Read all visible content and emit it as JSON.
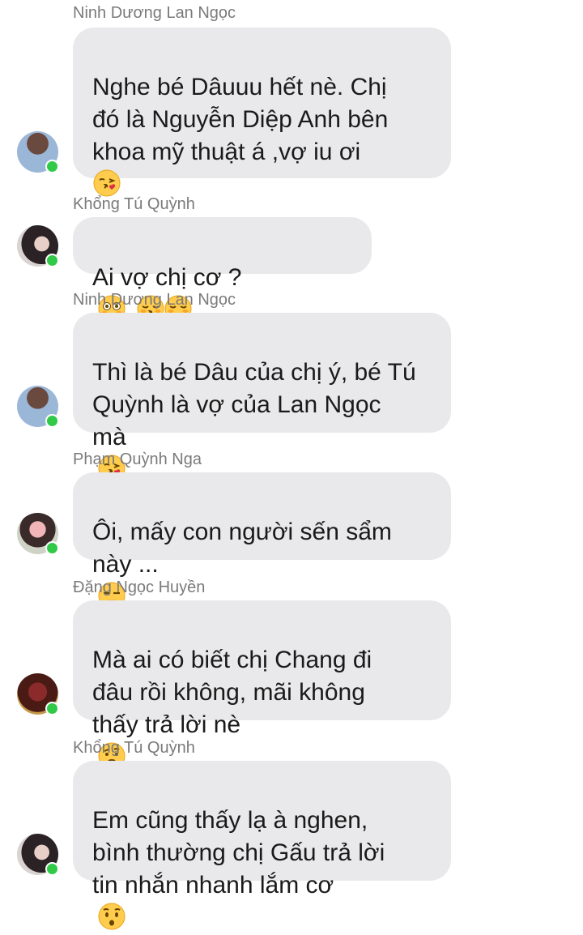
{
  "messages": [
    {
      "sender": "Ninh Dương Lan Ngọc",
      "text": "Nghe bé Dâuuu hết nè. Chị\nđó là Nguyễn Diệp Anh bên\nkhoa mỹ thuật á ,vợ iu ơi",
      "emojis_inline": [
        "kissing-heart-emoji"
      ],
      "emojis_extra_line": [
        "kissing-heart-emoji",
        "kissing-heart-emoji"
      ]
    },
    {
      "sender": "Khổng Tú Quỳnh",
      "text": "Ai vợ chị cơ ?",
      "emojis_inline": [
        "flushed-emoji",
        "kissing-closed-eyes-emoji",
        "relieved-emoji"
      ]
    },
    {
      "sender": "Ninh Dương Lan Ngọc",
      "text": "Thì là bé Dâu của chị ý, bé Tú\nQuỳnh là vợ của Lan Ngọc\nmà",
      "emojis_inline": [
        "kissing-heart-emoji"
      ]
    },
    {
      "sender": "Phạm Quỳnh Nga",
      "text": "Ôi, mấy con người sến sẩm\nnày ...",
      "emojis_inline": [
        "expressionless-emoji"
      ]
    },
    {
      "sender": "Đặng Ngọc Huyền",
      "text": "Mà ai có biết chị Chang đi\nđâu rồi không, mãi không\nthấy trả lời nè",
      "emojis_inline": [
        "thinking-emoji"
      ]
    },
    {
      "sender": "Khổng Tú Quỳnh",
      "text": "Em cũng thấy lạ à nghen,\nbình thường chị Gấu trả lời\ntin nhắn nhanh lắm cơ",
      "emojis_inline": [
        "hushed-emoji"
      ]
    }
  ],
  "colors": {
    "bubble": "#e9e9eb",
    "sender_name": "#7a7a7a",
    "online_dot": "#31c948"
  }
}
